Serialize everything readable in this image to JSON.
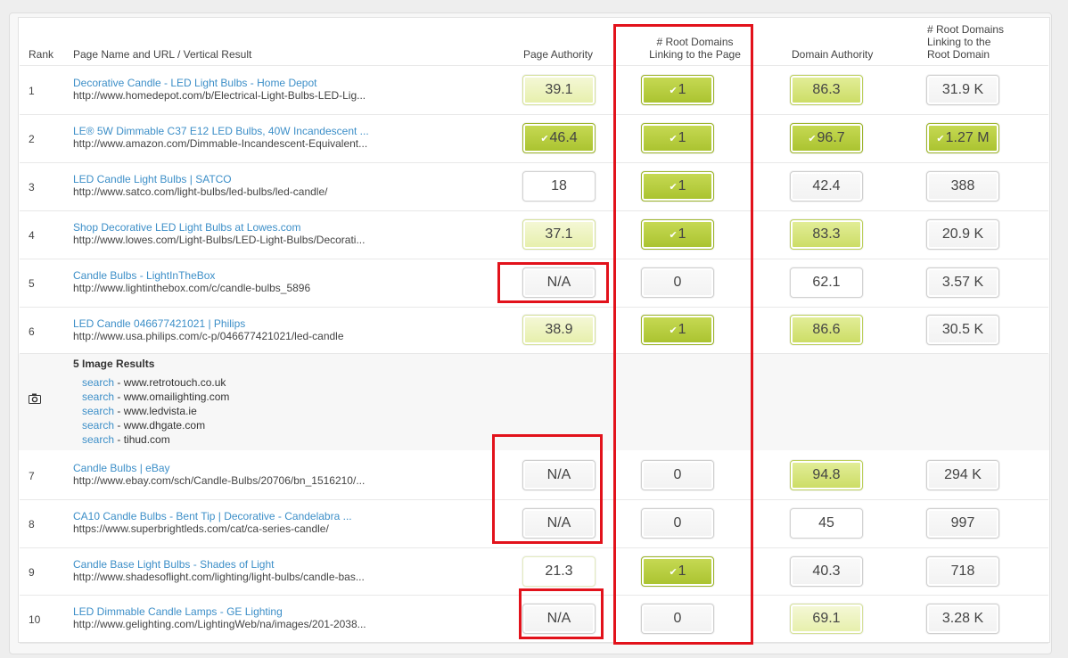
{
  "headers": {
    "rank": "Rank",
    "page_name": "Page Name and URL / Vertical Result",
    "page_authority": "Page Authority",
    "root_domains_page": "# Root Domains Linking to the Page",
    "domain_authority": "Domain Authority",
    "root_domains_root": "# Root Domains Linking to the Root Domain"
  },
  "rows": [
    {
      "rank": "1",
      "title": "Decorative Candle - LED Light Bulbs - Home Depot",
      "url": "http://www.homedepot.com/b/Electrical-Light-Bulbs-LED-Lig...",
      "pa": "39.1",
      "rd": "1",
      "da": "86.3",
      "rdr": "31.9 K"
    },
    {
      "rank": "2",
      "title": "LE® 5W Dimmable C37 E12 LED Bulbs, 40W Incandescent ...",
      "url": "http://www.amazon.com/Dimmable-Incandescent-Equivalent...",
      "pa": "46.4",
      "rd": "1",
      "da": "96.7",
      "rdr": "1.27 M"
    },
    {
      "rank": "3",
      "title": "LED Candle Light Bulbs | SATCO",
      "url": "http://www.satco.com/light-bulbs/led-bulbs/led-candle/",
      "pa": "18",
      "rd": "1",
      "da": "42.4",
      "rdr": "388"
    },
    {
      "rank": "4",
      "title": "Shop Decorative LED Light Bulbs at Lowes.com",
      "url": "http://www.lowes.com/Light-Bulbs/LED-Light-Bulbs/Decorati...",
      "pa": "37.1",
      "rd": "1",
      "da": "83.3",
      "rdr": "20.9 K"
    },
    {
      "rank": "5",
      "title": "Candle Bulbs - LightInTheBox",
      "url": "http://www.lightinthebox.com/c/candle-bulbs_5896",
      "pa": "N/A",
      "rd": "0",
      "da": "62.1",
      "rdr": "3.57 K"
    },
    {
      "rank": "6",
      "title": "LED Candle 046677421021 | Philips",
      "url": "http://www.usa.philips.com/c-p/046677421021/led-candle",
      "pa": "38.9",
      "rd": "1",
      "da": "86.6",
      "rdr": "30.5 K"
    },
    {
      "rank": "7",
      "title": "Candle Bulbs | eBay",
      "url": "http://www.ebay.com/sch/Candle-Bulbs/20706/bn_1516210/...",
      "pa": "N/A",
      "rd": "0",
      "da": "94.8",
      "rdr": "294 K"
    },
    {
      "rank": "8",
      "title": "CA10 Candle Bulbs - Bent Tip | Decorative - Candelabra ...",
      "url": "https://www.superbrightleds.com/cat/ca-series-candle/",
      "pa": "N/A",
      "rd": "0",
      "da": "45",
      "rdr": "997"
    },
    {
      "rank": "9",
      "title": "Candle Base Light Bulbs - Shades of Light",
      "url": "http://www.shadesoflight.com/lighting/light-bulbs/candle-bas...",
      "pa": "21.3",
      "rd": "1",
      "da": "40.3",
      "rdr": "718"
    },
    {
      "rank": "10",
      "title": "LED Dimmable Candle Lamps - GE Lighting",
      "url": "http://www.gelighting.com/LightingWeb/na/images/201-2038...",
      "pa": "N/A",
      "rd": "0",
      "da": "69.1",
      "rdr": "3.28 K"
    }
  ],
  "image_results": {
    "title": "5 Image Results",
    "icon": "camera-icon",
    "link_label": "search",
    "items": [
      "- www.retrotouch.co.uk",
      "- www.omailighting.com",
      "- www.ledvista.ie",
      "- www.dhgate.com",
      "- tihud.com"
    ]
  },
  "colors": {
    "highlight": "#e2121b",
    "link": "#3d8fc8",
    "metric_strong": "#a9c22e",
    "metric_light": "#e6efaa"
  }
}
